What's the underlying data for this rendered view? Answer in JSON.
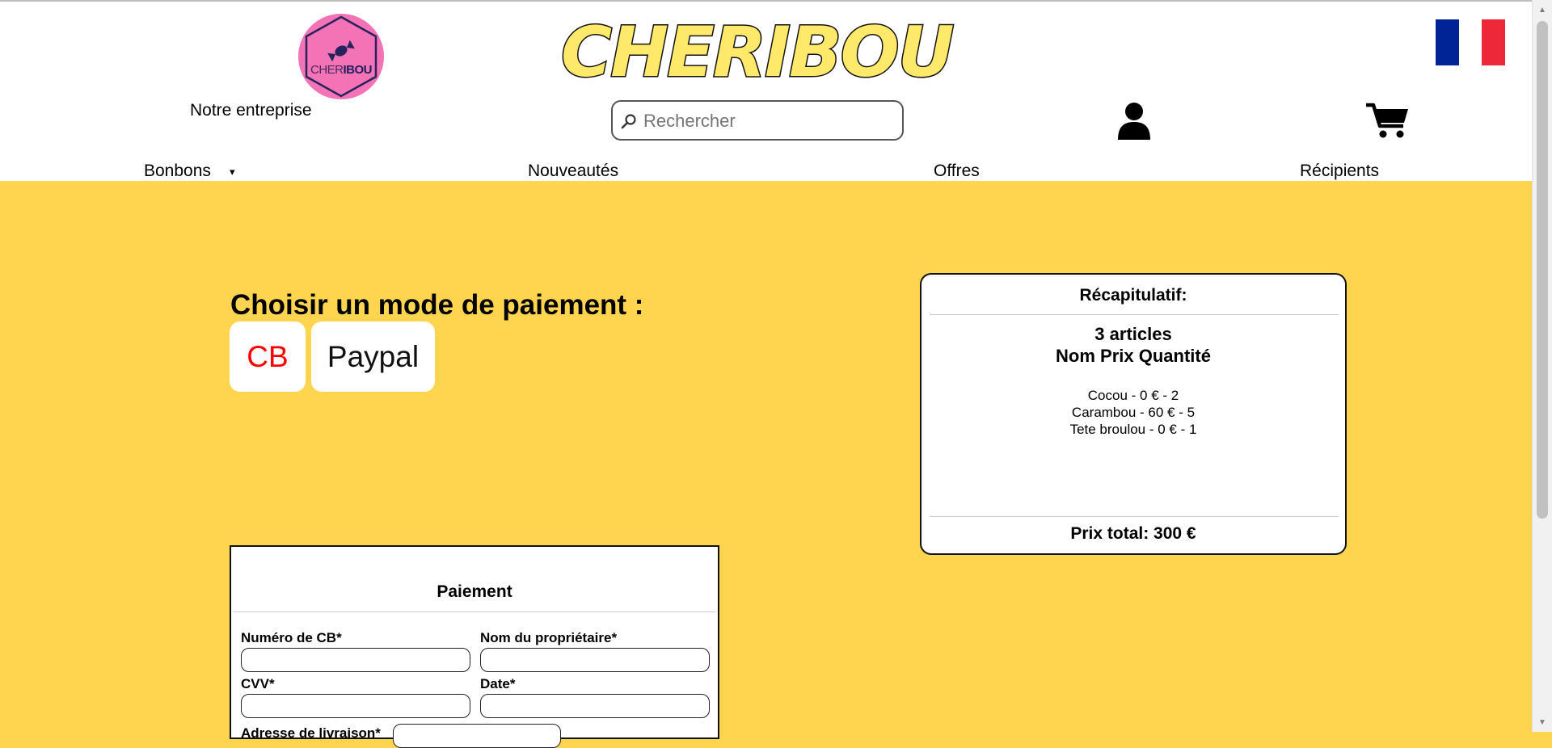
{
  "header": {
    "logo": {
      "text_part1": "CHER",
      "text_part2": "IBOU"
    },
    "company_link": "Notre entreprise",
    "brand_title": "CHERIBOU",
    "search": {
      "placeholder": "Rechercher",
      "value": ""
    },
    "flag_colors": [
      "#002395",
      "#ffffff",
      "#ED2939"
    ]
  },
  "nav": {
    "items": [
      {
        "label": "Bonbons",
        "arrow": "▾"
      },
      {
        "label": "Nouveautés"
      },
      {
        "label": "Offres"
      },
      {
        "label": "Récipients"
      }
    ]
  },
  "payment": {
    "title": "Choisir un mode de paiement :",
    "methods": [
      {
        "label": "CB",
        "color": "#ff0000"
      },
      {
        "label": "Paypal",
        "color": "#111111"
      }
    ]
  },
  "recap": {
    "title": "Récapitulatif:",
    "count": "3 articles",
    "columns_header": "Nom Prix Quantité",
    "items": [
      "Cocou - 0 € - 2",
      "Carambou - 60 € - 5",
      "Tete broulou - 0 € - 1"
    ],
    "total": "Prix total: 300 €"
  },
  "payment_form": {
    "title": "Paiement",
    "fields": {
      "card_number": {
        "label": "Numéro de CB*",
        "value": ""
      },
      "owner_name": {
        "label": "Nom du propriétaire*",
        "value": ""
      },
      "cvv": {
        "label": "CVV*",
        "value": ""
      },
      "date": {
        "label": "Date*",
        "value": ""
      },
      "delivery_address": {
        "label": "Adresse de livraison*",
        "value": ""
      }
    }
  },
  "colors": {
    "page_background": "#ffd54f",
    "logo_pink": "#f472b6",
    "brand_yellow": "#ffe96a"
  }
}
